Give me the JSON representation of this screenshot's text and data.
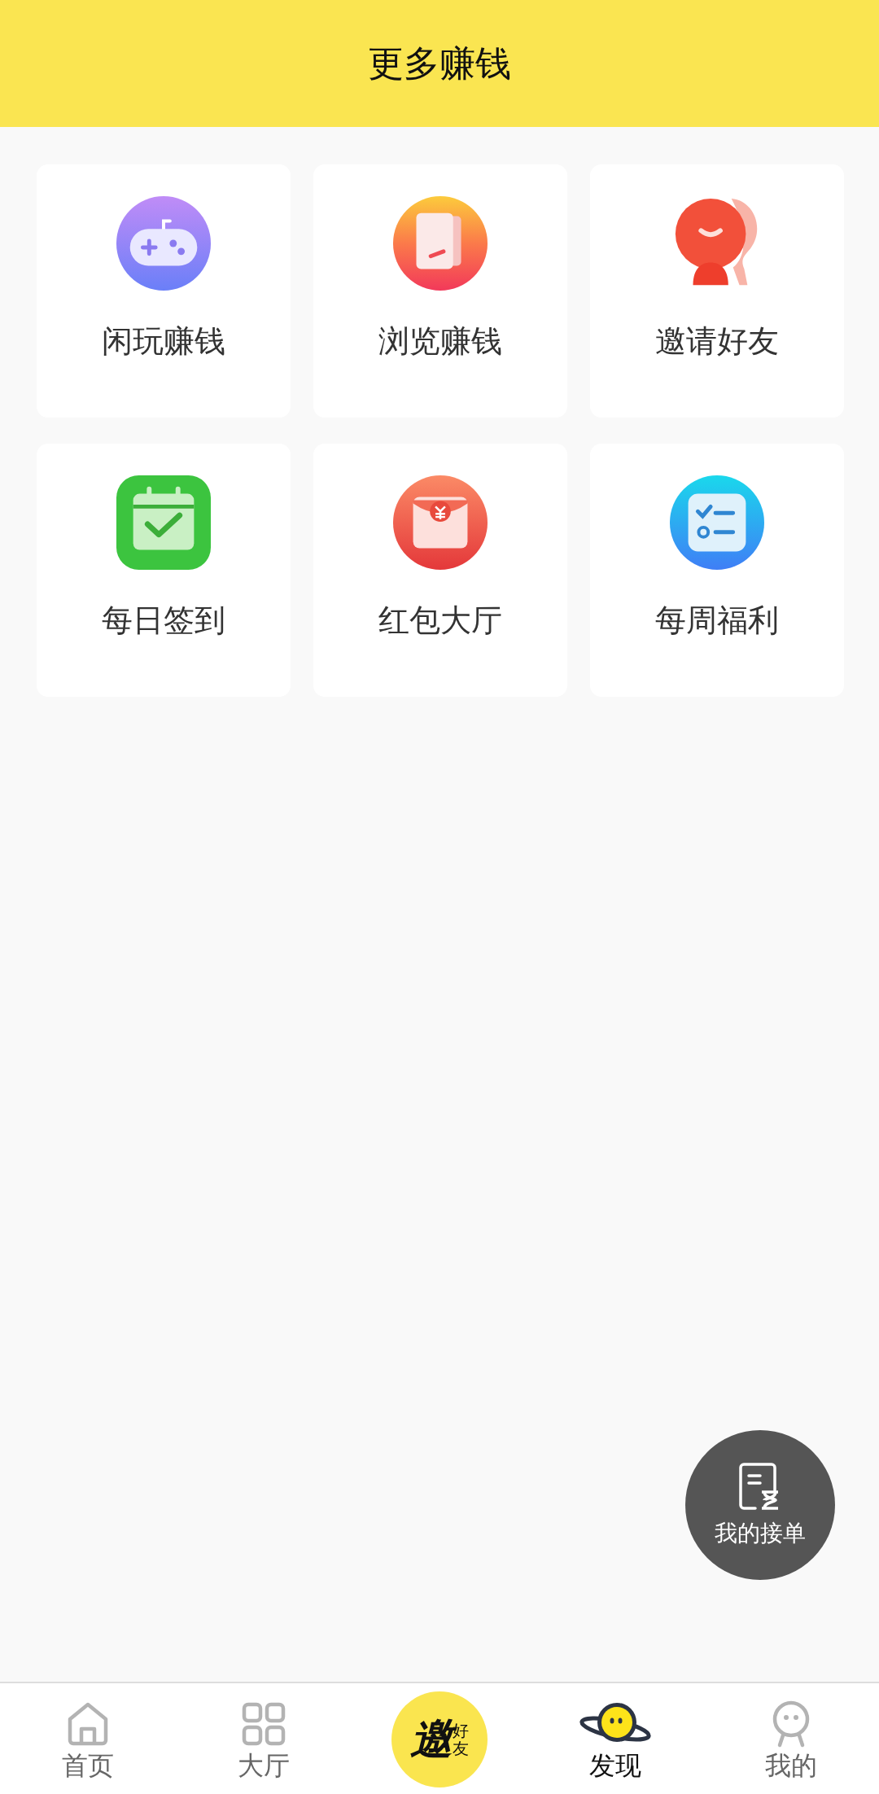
{
  "header": {
    "title": "更多赚钱"
  },
  "cards": [
    {
      "label": "闲玩赚钱"
    },
    {
      "label": "浏览赚钱"
    },
    {
      "label": "邀请好友"
    },
    {
      "label": "每日签到"
    },
    {
      "label": "红包大厅"
    },
    {
      "label": "每周福利"
    }
  ],
  "floating_button": {
    "label": "我的接单"
  },
  "nav": [
    {
      "kind": "tab",
      "label": "首页",
      "selected": false
    },
    {
      "kind": "tab",
      "label": "大厅",
      "selected": false
    },
    {
      "kind": "invite",
      "big": "邀",
      "small": "好友"
    },
    {
      "kind": "tab",
      "label": "发现",
      "selected": true
    },
    {
      "kind": "tab",
      "label": "我的",
      "selected": false
    }
  ]
}
